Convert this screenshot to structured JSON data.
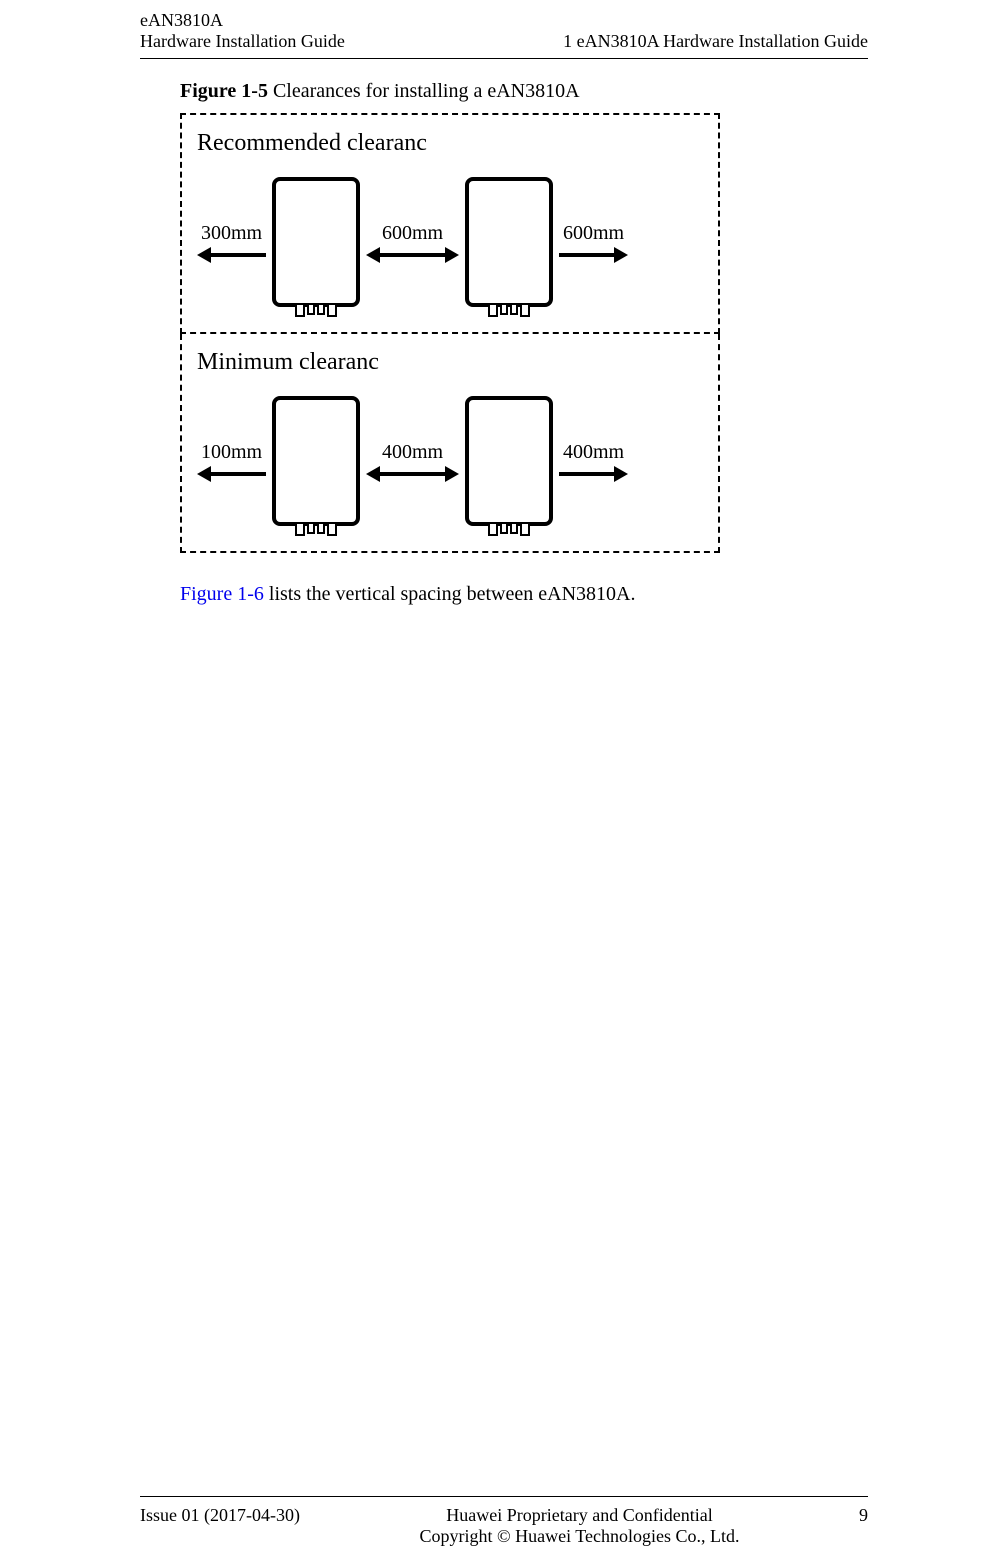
{
  "header": {
    "productName": "eAN3810A",
    "docTitle": "Hardware Installation Guide",
    "sectionTitle": "1 eAN3810A Hardware Installation Guide"
  },
  "figure": {
    "labelBold": "Figure 1-5",
    "labelRest": " Clearances for installing a eAN3810A",
    "recommended": {
      "title": "Recommended clearanc",
      "dims": {
        "left": "300mm",
        "middle": "600mm",
        "right": "600mm"
      }
    },
    "minimum": {
      "title": "Minimum clearanc",
      "dims": {
        "left": "100mm",
        "middle": "400mm",
        "right": "400mm"
      }
    }
  },
  "body": {
    "crossRef": "Figure 1-6",
    "crossRefText": " lists the vertical spacing between eAN3810A."
  },
  "footer": {
    "issue": "Issue 01 (2017-04-30)",
    "confidential": "Huawei Proprietary and Confidential",
    "copyright": "Copyright © Huawei Technologies Co., Ltd.",
    "pageNumber": "9"
  }
}
